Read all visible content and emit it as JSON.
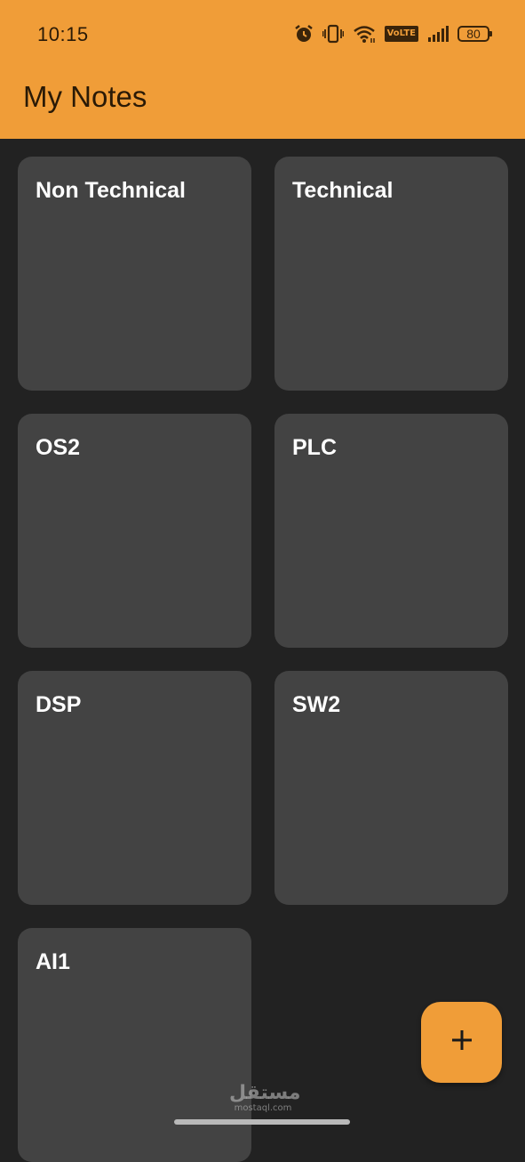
{
  "status_bar": {
    "time": "10:15",
    "volte": "VoLTE",
    "battery": "80",
    "icons": [
      "alarm-icon",
      "vibrate-icon",
      "wifi-icon",
      "volte-icon",
      "signal-icon",
      "battery-icon"
    ]
  },
  "app_bar": {
    "title": "My Notes",
    "color": "#f09d38"
  },
  "notes": [
    {
      "title": "Non Technical"
    },
    {
      "title": "Technical"
    },
    {
      "title": "OS2"
    },
    {
      "title": "PLC"
    },
    {
      "title": "DSP"
    },
    {
      "title": "SW2"
    },
    {
      "title": "AI1"
    }
  ],
  "fab": {
    "icon": "plus-icon"
  },
  "watermark": {
    "arabic": "مستقل",
    "latin": "mostaql.com"
  },
  "colors": {
    "background": "#222222",
    "card": "#434343",
    "accent": "#f09d38"
  }
}
